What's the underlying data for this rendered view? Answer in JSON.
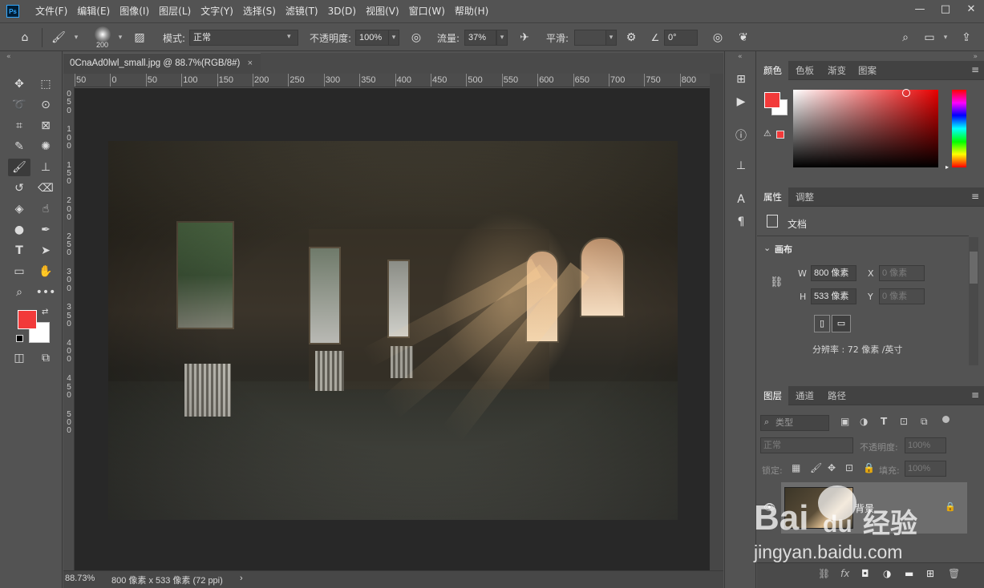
{
  "menu": {
    "logo": "Ps",
    "items": [
      "文件(F)",
      "编辑(E)",
      "图像(I)",
      "图层(L)",
      "文字(Y)",
      "选择(S)",
      "滤镜(T)",
      "3D(D)",
      "视图(V)",
      "窗口(W)",
      "帮助(H)"
    ]
  },
  "window_controls": {
    "minimize": "—",
    "maximize": "□",
    "close": "✕"
  },
  "options": {
    "brush_size": "200",
    "mode_label": "模式:",
    "mode_value": "正常",
    "opacity_label": "不透明度:",
    "opacity_value": "100%",
    "flow_label": "流量:",
    "flow_value": "37%",
    "smooth_label": "平滑:",
    "smooth_value": "",
    "angle_value": "0°"
  },
  "document": {
    "tab_title": "0CnaAd0lwl_small.jpg @ 88.7%(RGB/8#)",
    "tab_close": "×",
    "ruler_top": [
      "50",
      "0",
      "50",
      "100",
      "150",
      "200",
      "250",
      "300",
      "350",
      "400",
      "450",
      "500",
      "550",
      "600",
      "650",
      "700",
      "750",
      "800"
    ],
    "ruler_left": [
      "0",
      "5",
      "0",
      "1",
      "0",
      "0",
      "1",
      "5",
      "0",
      "2",
      "0",
      "0",
      "2",
      "5",
      "0",
      "3",
      "0",
      "0",
      "3",
      "5",
      "0",
      "4",
      "0",
      "0",
      "4",
      "5",
      "0",
      "5",
      "0",
      "0"
    ],
    "zoom": "88.73%",
    "size_info": "800 像素 x 533 像素 (72 ppi)",
    "status_arrow": "›"
  },
  "color_panel": {
    "tabs": [
      "颜色",
      "色板",
      "渐变",
      "图案"
    ],
    "fg_color": "#f23a3a",
    "bg_color": "#ffffff"
  },
  "properties_panel": {
    "tabs": [
      "属性",
      "调整"
    ],
    "doc_label": "文档",
    "canvas_header": "画布",
    "w_label": "W",
    "w_value": "800 像素",
    "h_label": "H",
    "h_value": "533 像素",
    "x_label": "X",
    "x_value": "0 像素",
    "y_label": "Y",
    "y_value": "0 像素",
    "resolution": "分辨率 : 72 像素 /英寸"
  },
  "layers_panel": {
    "tabs": [
      "图层",
      "通道",
      "路径"
    ],
    "filter_label": "类型",
    "blend_mode": "正常",
    "opacity_label": "不透明度:",
    "opacity_value": "100%",
    "lock_label": "锁定:",
    "fill_label": "填充:",
    "fill_value": "100%",
    "layer_name": "背景"
  },
  "watermark": {
    "brand": "Bai",
    "brand2": "du",
    "brand3": "经验",
    "url": "jingyan.baidu.com"
  }
}
